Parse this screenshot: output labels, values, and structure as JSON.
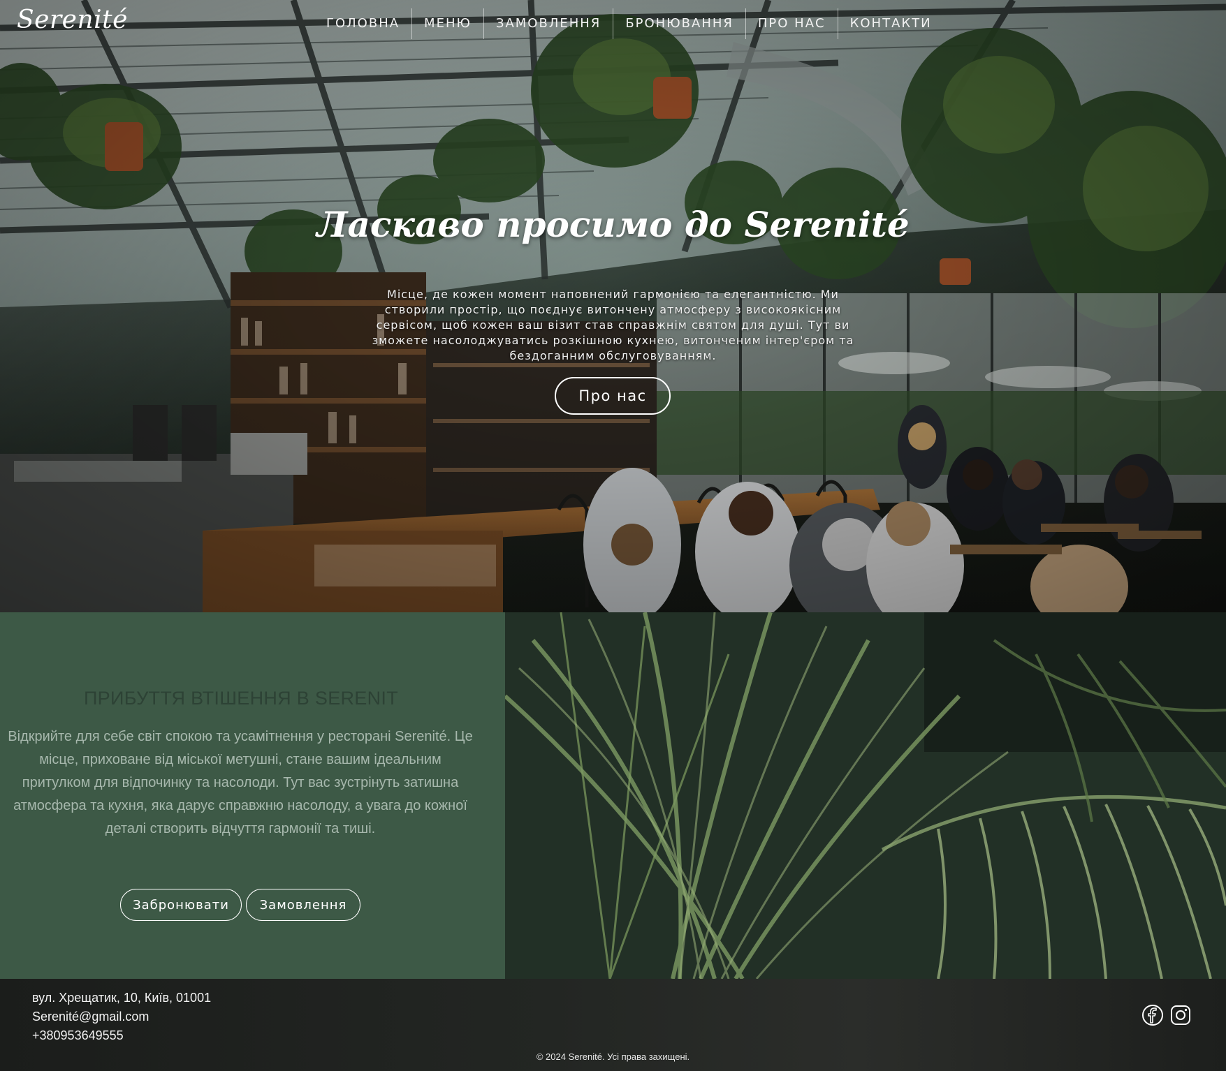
{
  "header": {
    "logo": "Serenité",
    "nav": [
      "ГОЛОВНА",
      "МЕНЮ",
      "ЗАМОВЛЕННЯ",
      "БРОНЮВАННЯ",
      "ПРО НАС",
      "КОНТАКТИ"
    ]
  },
  "hero": {
    "title": "Ласкаво просимо до Serenité",
    "text": "Місце, де кожен момент наповнений гармонією та елегантністю. Ми створили простір, що поєднує витончену атмосферу з високоякісним сервісом, щоб кожен ваш візит став справжнім святом для душі. Тут ви зможете насолоджуватись розкішною кухнею, витонченим інтер'єром та бездоганним обслуговуванням.",
    "button": "Про нас"
  },
  "about": {
    "title": "ПРИБУТТЯ ВТІШЕННЯ В SERENIT",
    "text": "Відкрийте для себе світ спокою та усамітнення у ресторані Serenité. Це місце, приховане від міської метушні, стане вашим ідеальним притулком для відпочинку та насолоди. Тут вас зустрінуть затишна атмосфера та кухня, яка дарує справжню насолоду, а увага до кожної деталі створить відчуття гармонії та тиші.",
    "buttons": [
      "Забронювати",
      "Замовлення"
    ]
  },
  "footer": {
    "address": "вул. Хрещатик, 10, Київ, 01001",
    "email": "Serenité@gmail.com",
    "phone": "+380953649555",
    "social": [
      "facebook-icon",
      "instagram-icon"
    ],
    "copyright": "© 2024 Serenité. Усі права захищені."
  },
  "colors": {
    "about_bg": "#3d5946",
    "about_title": "#2d4235",
    "about_text": "#a7b8ad",
    "footer_bg": "#1f211f"
  }
}
